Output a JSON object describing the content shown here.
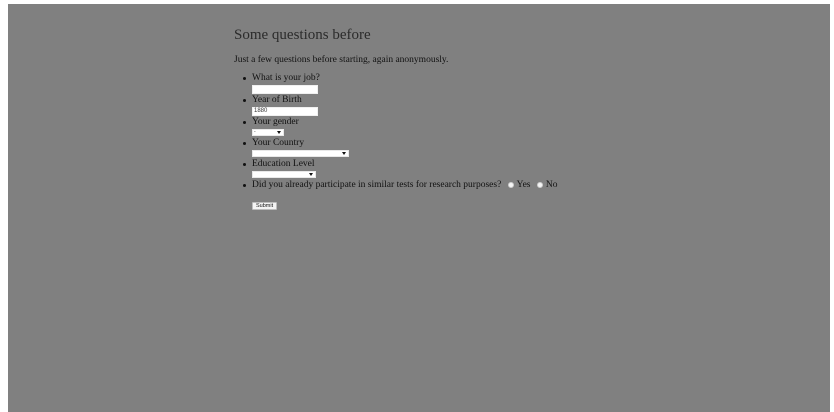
{
  "page": {
    "title": "Some questions before",
    "intro": "Just a few questions before starting, again anonymously."
  },
  "form": {
    "job_label": "What is your job?",
    "job_value": "",
    "birth_label": "Year of Birth",
    "birth_value": "1880",
    "gender_label": "Your gender",
    "gender_value": "-",
    "country_label": "Your Country",
    "country_value": "",
    "education_label": "Education Level",
    "education_value": "",
    "participate_label": "Did you already participate in similar tests for research purposes?",
    "yes_label": "Yes",
    "no_label": "No",
    "submit_label": "Submit"
  }
}
